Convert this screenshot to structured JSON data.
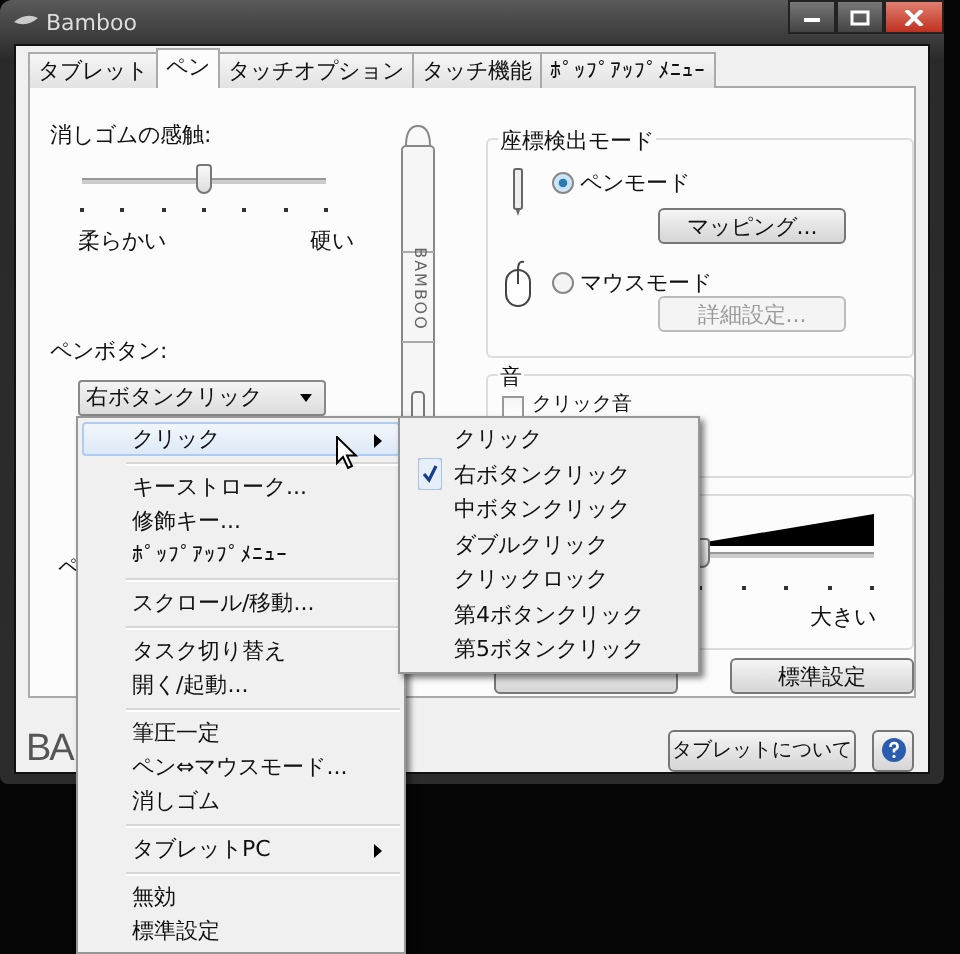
{
  "window": {
    "title": "Bamboo"
  },
  "tabs": [
    {
      "label": "タブレット",
      "selected": false
    },
    {
      "label": "ペン",
      "selected": true
    },
    {
      "label": "タッチオプション",
      "selected": false
    },
    {
      "label": "タッチ機能",
      "selected": false
    },
    {
      "label": "ﾎﾟｯﾌﾟｱｯﾌﾟﾒﾆｭｰ",
      "selected": false
    }
  ],
  "eraser_feel": {
    "label": "消しゴムの感触:",
    "level": 0.5,
    "min_label": "柔らかい",
    "max_label": "硬い"
  },
  "pen_logo": "BAMBOO",
  "pen_button": {
    "label": "ペンボタン:",
    "value": "右ボタンクリック"
  },
  "hidden_label": "ペ",
  "tracking_mode": {
    "label": "座標検出モード",
    "options": [
      {
        "label": "ペンモード",
        "selected": true,
        "button": {
          "label": "マッピング...",
          "disabled": false
        }
      },
      {
        "label": "マウスモード",
        "selected": false,
        "button": {
          "label": "詳細設定...",
          "disabled": true
        }
      }
    ]
  },
  "sound": {
    "label": "音",
    "click_sound": {
      "label": "クリック音",
      "checked": false
    }
  },
  "volume": {
    "level": 0.5,
    "max_label": "大きい"
  },
  "reset_button": "標準設定",
  "logo": "BA",
  "about_button": "タブレットについて",
  "context_menu": [
    {
      "kind": "item",
      "label": "クリック",
      "highlighted": true,
      "submenu": true
    },
    {
      "kind": "separator"
    },
    {
      "kind": "item",
      "label": "キーストローク...",
      "highlighted": false,
      "submenu": false
    },
    {
      "kind": "item",
      "label": "修飾キー...",
      "highlighted": false,
      "submenu": false
    },
    {
      "kind": "item",
      "label": "ﾎﾟｯﾌﾟｱｯﾌﾟﾒﾆｭｰ",
      "highlighted": false,
      "submenu": false
    },
    {
      "kind": "separator"
    },
    {
      "kind": "item",
      "label": "スクロール/移動...",
      "highlighted": false,
      "submenu": false
    },
    {
      "kind": "separator"
    },
    {
      "kind": "item",
      "label": "タスク切り替え",
      "highlighted": false,
      "submenu": false
    },
    {
      "kind": "item",
      "label": "開く/起動...",
      "highlighted": false,
      "submenu": false
    },
    {
      "kind": "separator"
    },
    {
      "kind": "item",
      "label": "筆圧一定",
      "highlighted": false,
      "submenu": false
    },
    {
      "kind": "item",
      "label": "ペン⇔マウスモード...",
      "highlighted": false,
      "submenu": false
    },
    {
      "kind": "item",
      "label": "消しゴム",
      "highlighted": false,
      "submenu": false
    },
    {
      "kind": "separator"
    },
    {
      "kind": "item",
      "label": "タブレットPC",
      "highlighted": false,
      "submenu": true
    },
    {
      "kind": "separator"
    },
    {
      "kind": "item",
      "label": "無効",
      "highlighted": false,
      "submenu": false
    },
    {
      "kind": "item",
      "label": "標準設定",
      "highlighted": false,
      "submenu": false
    }
  ],
  "submenu": [
    {
      "label": "クリック",
      "checked": false
    },
    {
      "label": "右ボタンクリック",
      "checked": true
    },
    {
      "label": "中ボタンクリック",
      "checked": false
    },
    {
      "label": "ダブルクリック",
      "checked": false
    },
    {
      "label": "クリックロック",
      "checked": false
    },
    {
      "label": "第4ボタンクリック",
      "checked": false
    },
    {
      "label": "第5ボタンクリック",
      "checked": false
    }
  ]
}
